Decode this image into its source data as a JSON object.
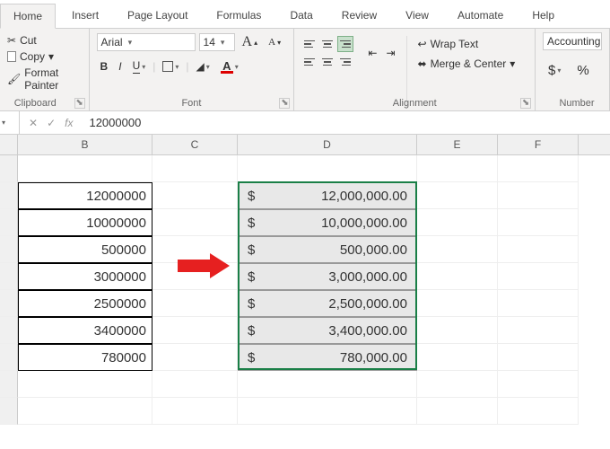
{
  "tabs": [
    "Home",
    "Insert",
    "Page Layout",
    "Formulas",
    "Data",
    "Review",
    "View",
    "Automate",
    "Help"
  ],
  "active_tab": "Home",
  "clipboard": {
    "cut": "Cut",
    "copy": "Copy",
    "format_painter": "Format Painter",
    "group": "Clipboard"
  },
  "font": {
    "name": "Arial",
    "size": "14",
    "group": "Font",
    "bold": "B",
    "italic": "I",
    "underline": "U"
  },
  "alignment": {
    "group": "Alignment",
    "wrap": "Wrap Text",
    "merge": "Merge & Center"
  },
  "number": {
    "group": "Number",
    "format": "Accounting",
    "dollar": "$",
    "percent": "%"
  },
  "formula_bar": {
    "value": "12000000",
    "fx": "fx"
  },
  "columns": [
    "B",
    "C",
    "D",
    "E",
    "F"
  ],
  "data_b": [
    "12000000",
    "10000000",
    "500000",
    "3000000",
    "2500000",
    "3400000",
    "780000"
  ],
  "data_d": [
    "12,000,000.00",
    "10,000,000.00",
    "500,000.00",
    "3,000,000.00",
    "2,500,000.00",
    "3,400,000.00",
    "780,000.00"
  ],
  "currency": "$"
}
